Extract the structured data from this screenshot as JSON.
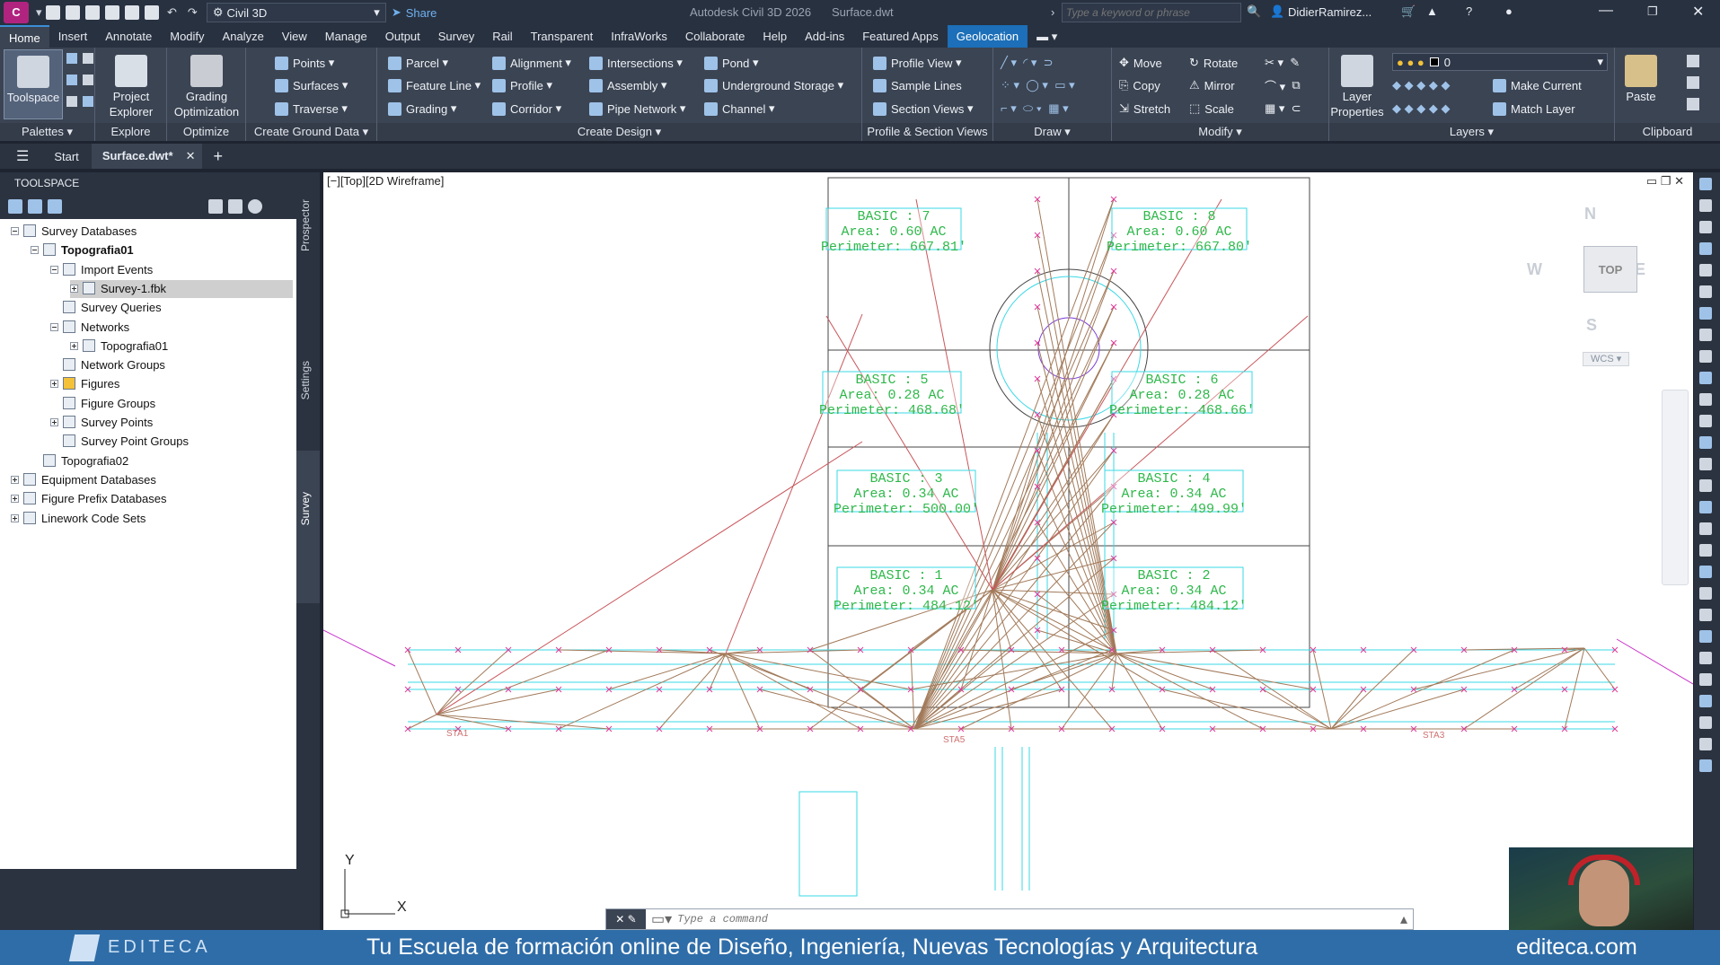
{
  "app": {
    "app_menu_letter": "C",
    "workspace": "Civil 3D",
    "share": "Share",
    "title": "Autodesk Civil 3D 2026",
    "filename": "Surface.dwt",
    "search_placeholder": "Type a keyword or phrase",
    "user": "DidierRamirez..."
  },
  "ribbon_tabs": [
    "Home",
    "Insert",
    "Annotate",
    "Modify",
    "Analyze",
    "View",
    "Manage",
    "Output",
    "Survey",
    "Rail",
    "Transparent",
    "InfraWorks",
    "Collaborate",
    "Help",
    "Add-ins",
    "Featured Apps",
    "Geolocation"
  ],
  "ribbon": {
    "palettes": {
      "toolspace": "Toolspace",
      "label": "Palettes"
    },
    "explore": {
      "project_explorer": "Project Explorer",
      "label": "Explore"
    },
    "optimize": {
      "grading_optimization": "Grading Optimization",
      "label": "Optimize"
    },
    "ground": {
      "points": "Points",
      "surfaces": "Surfaces",
      "traverse": "Traverse",
      "label": "Create Ground Data"
    },
    "design": {
      "parcel": "Parcel",
      "feature_line": "Feature Line",
      "grading": "Grading",
      "alignment": "Alignment",
      "profile": "Profile",
      "corridor": "Corridor",
      "intersections": "Intersections",
      "assembly": "Assembly",
      "pipe_network": "Pipe Network",
      "pond": "Pond",
      "underground_storage": "Underground Storage",
      "channel": "Channel",
      "label": "Create Design"
    },
    "profile_section": {
      "profile_view": "Profile View",
      "sample_lines": "Sample Lines",
      "section_views": "Section Views",
      "label": "Profile & Section Views"
    },
    "draw": {
      "label": "Draw"
    },
    "modify": {
      "move": "Move",
      "rotate": "Rotate",
      "copy": "Copy",
      "mirror": "Mirror",
      "stretch": "Stretch",
      "scale": "Scale",
      "label": "Modify"
    },
    "layers": {
      "layer_properties": "Layer Properties",
      "current_layer": "0",
      "make_current": "Make Current",
      "match_layer": "Match Layer",
      "label": "Layers"
    },
    "clipboard": {
      "paste": "Paste",
      "label": "Clipboard"
    }
  },
  "doc_tabs": {
    "start": "Start",
    "active": "Surface.dwt*"
  },
  "toolspace": {
    "title": "TOOLSPACE",
    "vtabs": [
      "Prospector",
      "Settings",
      "Survey"
    ],
    "tree": [
      {
        "label": "Survey Databases"
      },
      {
        "label": "Topografia01"
      },
      {
        "label": "Import Events"
      },
      {
        "label": "Survey-1.fbk"
      },
      {
        "label": "Survey Queries"
      },
      {
        "label": "Networks"
      },
      {
        "label": "Topografia01"
      },
      {
        "label": "Network Groups"
      },
      {
        "label": "Figures"
      },
      {
        "label": "Figure Groups"
      },
      {
        "label": "Survey Points"
      },
      {
        "label": "Survey Point Groups"
      },
      {
        "label": "Topografia02"
      },
      {
        "label": "Equipment Databases"
      },
      {
        "label": "Figure Prefix Databases"
      },
      {
        "label": "Linework Code Sets"
      }
    ]
  },
  "viewport": {
    "label": "[−][Top][2D Wireframe]",
    "viewcube": {
      "n": "N",
      "s": "S",
      "e": "E",
      "w": "W",
      "top": "TOP",
      "wcs": "WCS"
    },
    "ucs": {
      "x": "X",
      "y": "Y"
    },
    "parcels": [
      {
        "name": "BASIC : 7",
        "area": "Area: 0.60 AC",
        "perimeter": "Perimeter: 667.81'"
      },
      {
        "name": "BASIC : 8",
        "area": "Area: 0.60 AC",
        "perimeter": "Perimeter: 667.80'"
      },
      {
        "name": "BASIC : 5",
        "area": "Area: 0.28 AC",
        "perimeter": "Perimeter: 468.68'"
      },
      {
        "name": "BASIC : 6",
        "area": "Area: 0.28 AC",
        "perimeter": "Perimeter: 468.66'"
      },
      {
        "name": "BASIC : 3",
        "area": "Area: 0.34 AC",
        "perimeter": "Perimeter: 500.00'"
      },
      {
        "name": "BASIC : 4",
        "area": "Area: 0.34 AC",
        "perimeter": "Perimeter: 499.99'"
      },
      {
        "name": "BASIC : 1",
        "area": "Area: 0.34 AC",
        "perimeter": "Perimeter: 484.12'"
      },
      {
        "name": "BASIC : 2",
        "area": "Area: 0.34 AC",
        "perimeter": "Perimeter: 484.12'"
      }
    ],
    "station_labels": [
      "STA1",
      "STA5",
      "STA3"
    ],
    "command_placeholder": "Type a command"
  },
  "banner": {
    "logo": "EDITECA",
    "tagline": "Tu Escuela de formación online de Diseño, Ingeniería, Nuevas Tecnologías y Arquitectura",
    "url": "editeca.com"
  },
  "colors": {
    "accent": "#1c6fb8",
    "parcel_text": "#2fb84b",
    "parcel_box": "#39d8e6",
    "points": "#e0399b",
    "lines": "#a27a5a"
  }
}
